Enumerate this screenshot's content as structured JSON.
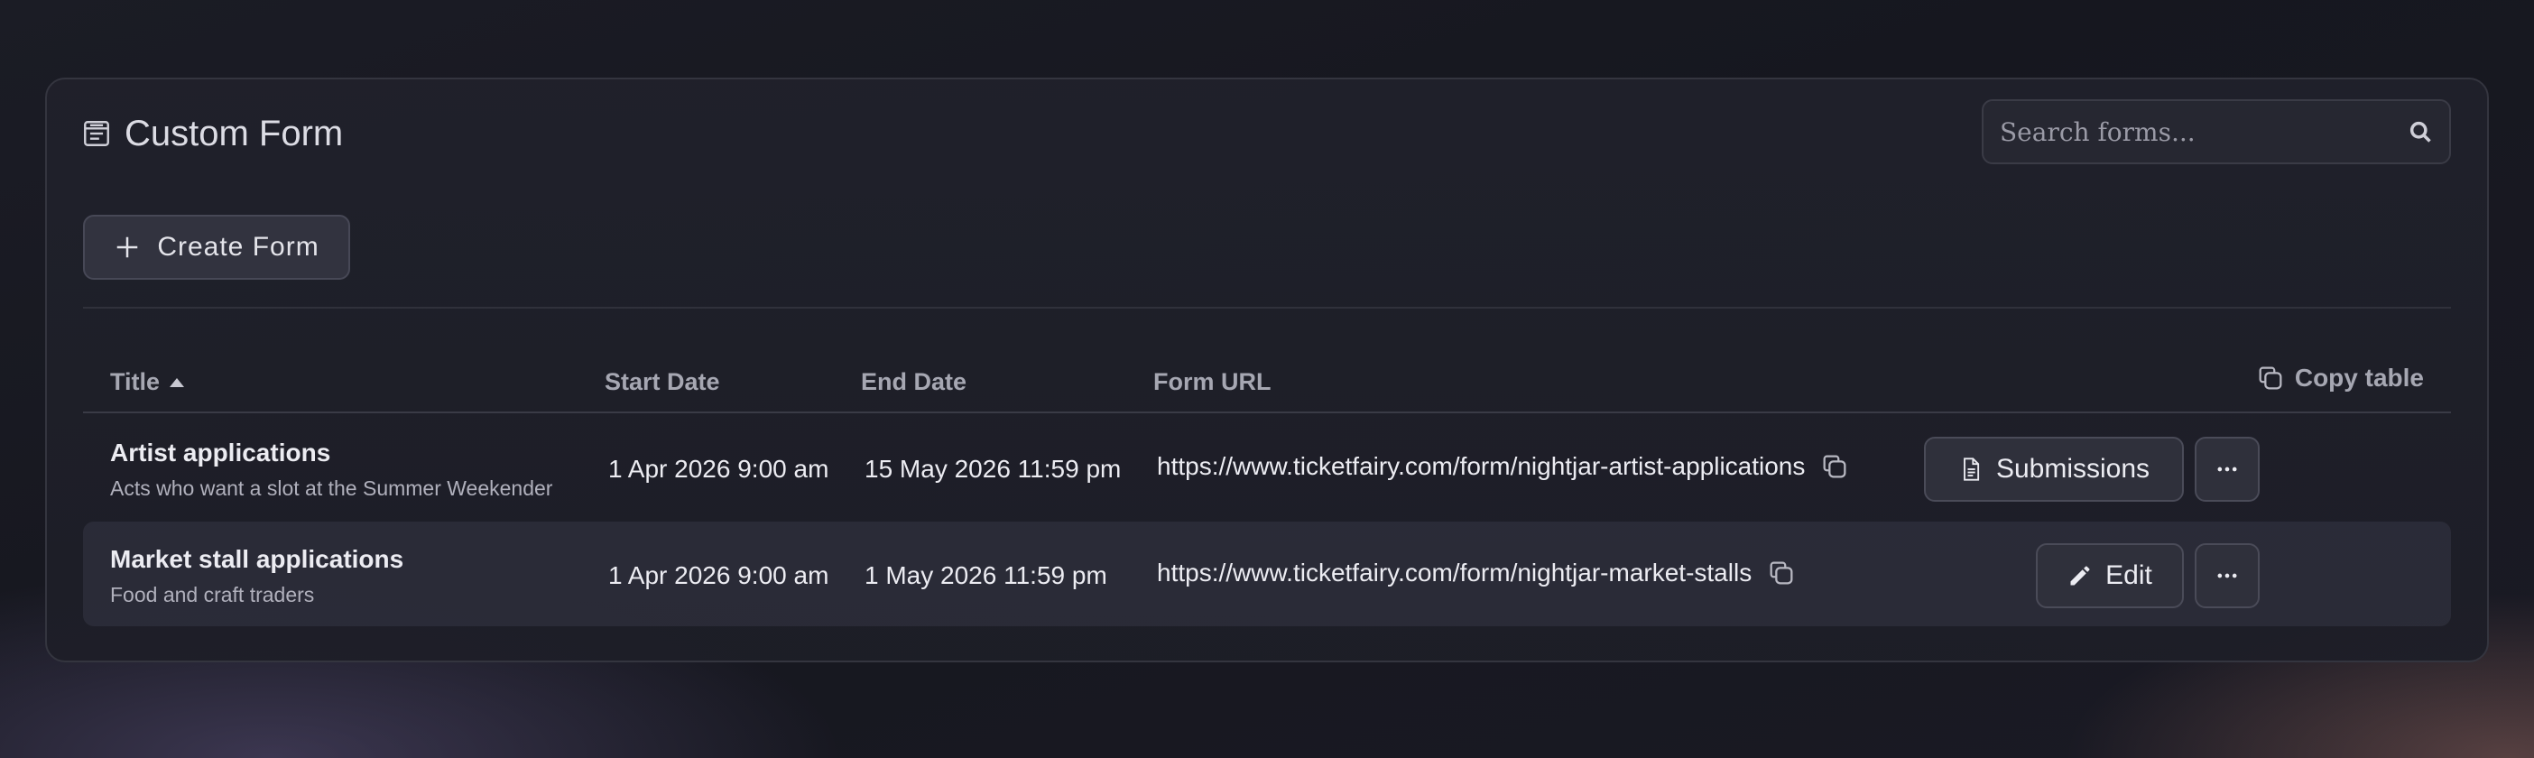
{
  "header": {
    "title": "Custom Form",
    "title_icon": "form-icon"
  },
  "search": {
    "placeholder": "Search forms...",
    "icon": "search-icon"
  },
  "toolbar": {
    "create_label": "Create Form"
  },
  "table": {
    "columns": {
      "title": "Title",
      "start": "Start Date",
      "end": "End Date",
      "url": "Form URL"
    },
    "sort": {
      "column": "Title",
      "direction": "ascending"
    },
    "copy_table_label": "Copy table",
    "rows": [
      {
        "title": "Artist applications",
        "subtitle": "Acts who want a slot at the Summer Weekender",
        "start": "1 Apr 2026 9:00 am",
        "end": "15 May 2026 11:59 pm",
        "url": "https://www.ticketfairy.com/form/nightjar-artist-applications",
        "action_label": "Submissions",
        "action_icon": "document-icon"
      },
      {
        "title": "Market stall applications",
        "subtitle": "Food and craft traders",
        "start": "1 Apr 2026 9:00 am",
        "end": "1 May 2026 11:59 pm",
        "url": "https://www.ticketfairy.com/form/nightjar-market-stalls",
        "action_label": "Edit",
        "action_icon": "pencil-icon"
      }
    ]
  },
  "colors": {
    "panel_border": "#34353f",
    "button_bg": "#2f303b",
    "text_primary": "#ececf2",
    "text_muted": "#a6a7b2"
  }
}
